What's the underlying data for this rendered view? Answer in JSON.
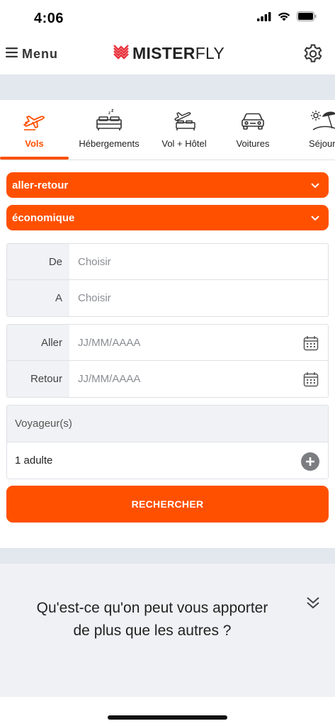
{
  "status_bar": {
    "time": "4:06"
  },
  "header": {
    "menu_label": "Menu",
    "logo": {
      "part1": "MISTER",
      "part2": "FLY"
    }
  },
  "tabs": [
    {
      "label": "Vols",
      "icon": "plane-icon",
      "active": true
    },
    {
      "label": "Hébergements",
      "icon": "bed-icon",
      "active": false
    },
    {
      "label": "Vol + Hôtel",
      "icon": "plane-hotel-icon",
      "active": false
    },
    {
      "label": "Voitures",
      "icon": "car-icon",
      "active": false
    },
    {
      "label": "Séjours",
      "icon": "beach-icon",
      "active": false
    }
  ],
  "trip_type": {
    "selected": "aller-retour"
  },
  "cabin_class": {
    "selected": "économique"
  },
  "route": {
    "from_label": "De",
    "from_placeholder": "Choisir",
    "to_label": "A",
    "to_placeholder": "Choisir"
  },
  "dates": {
    "depart_label": "Aller",
    "depart_placeholder": "JJ/MM/AAAA",
    "return_label": "Retour",
    "return_placeholder": "JJ/MM/AAAA"
  },
  "travellers": {
    "title": "Voyageur(s)",
    "count": "1 adulte"
  },
  "search_button": "RECHERCHER",
  "promo": {
    "line1": "Qu'est-ce qu'on peut vous apporter",
    "line2": "de plus que les autres ?"
  },
  "colors": {
    "accent": "#ff5000",
    "band": "#e3e7ee",
    "label_bg": "#f1f2f5"
  }
}
